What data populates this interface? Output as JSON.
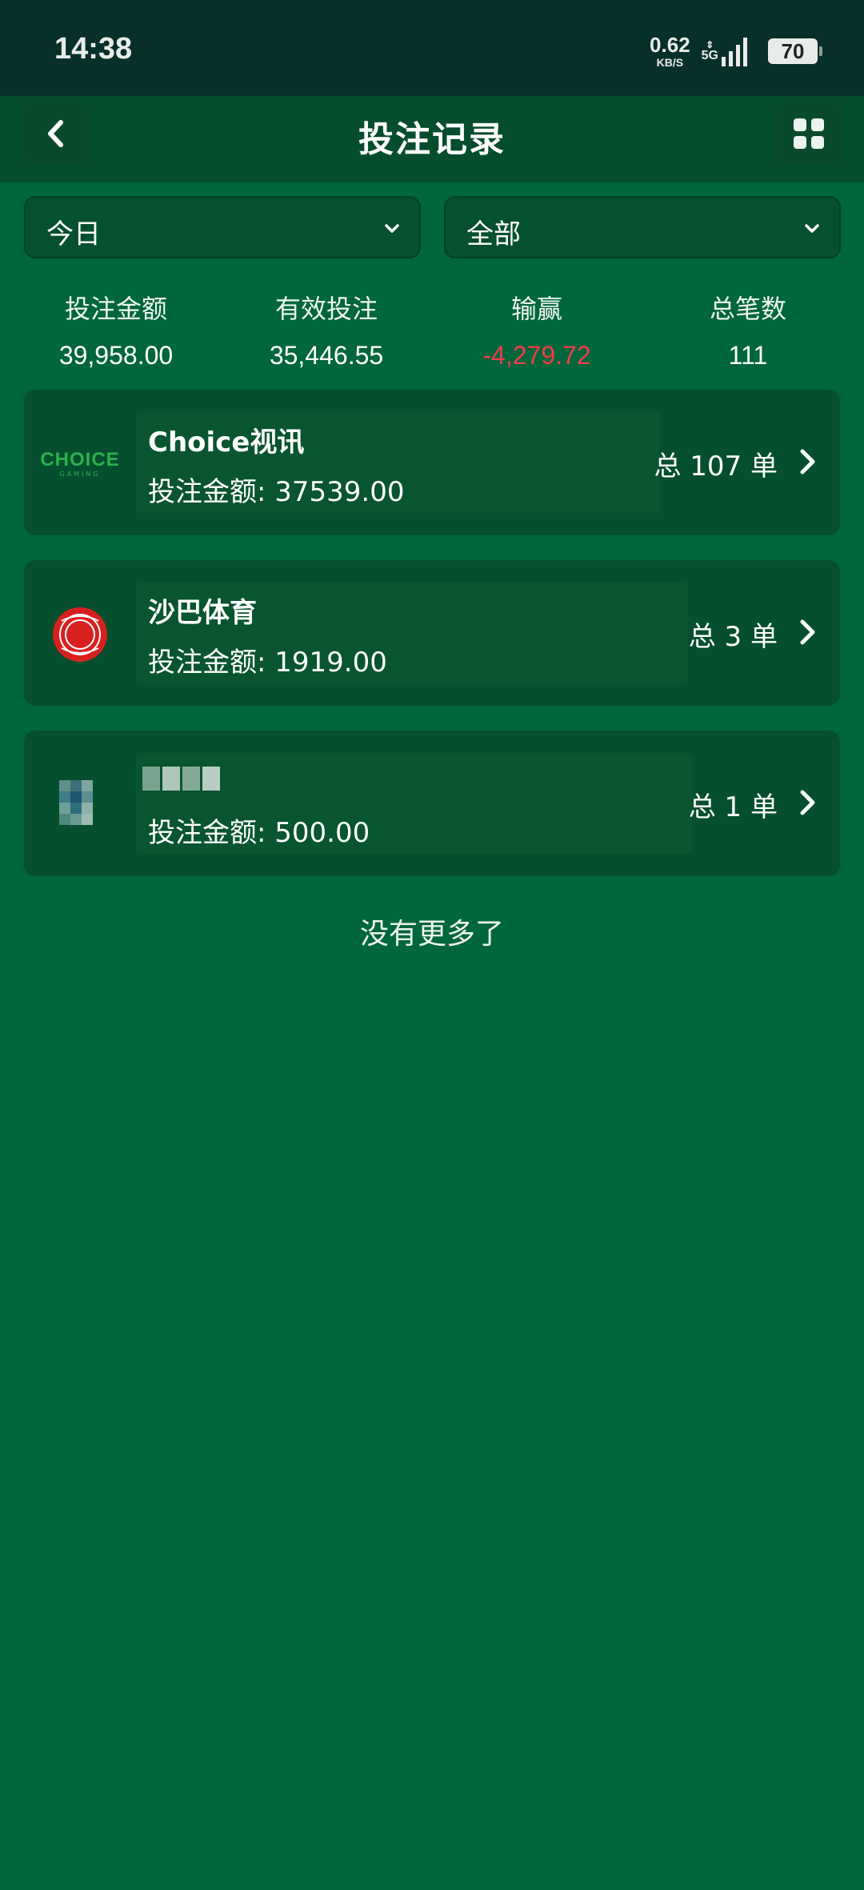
{
  "status_bar": {
    "time": "14:38",
    "net_speed": "0.62",
    "net_unit": "KB/S",
    "network_type": "5G",
    "battery": "70"
  },
  "header": {
    "title": "投注记录",
    "back_icon": "chevron-left-icon",
    "menu_icon": "grid-icon"
  },
  "filters": {
    "date": "今日",
    "category": "全部"
  },
  "stats": [
    {
      "label": "投注金额",
      "value": "39,958.00"
    },
    {
      "label": "有效投注",
      "value": "35,446.55"
    },
    {
      "label": "输赢",
      "value": "-4,279.72"
    },
    {
      "label": "总笔数",
      "value": "111"
    }
  ],
  "records": [
    {
      "name": "Choice视讯",
      "amount": "投注金额: 37539.00",
      "count": "总 107 单",
      "logo_text": "CHOICE",
      "logo_sub": "GAMING"
    },
    {
      "name": "沙巴体育",
      "amount": "投注金额: 1919.00",
      "count": "总 3 单"
    },
    {
      "name": "",
      "amount": "投注金额: 500.00",
      "count": "总 1 单"
    }
  ],
  "footer": {
    "no_more": "没有更多了"
  },
  "colors": {
    "background": "#00663b",
    "header": "#054d2d",
    "card": "#054f2e",
    "negative": "#f03c4a"
  }
}
